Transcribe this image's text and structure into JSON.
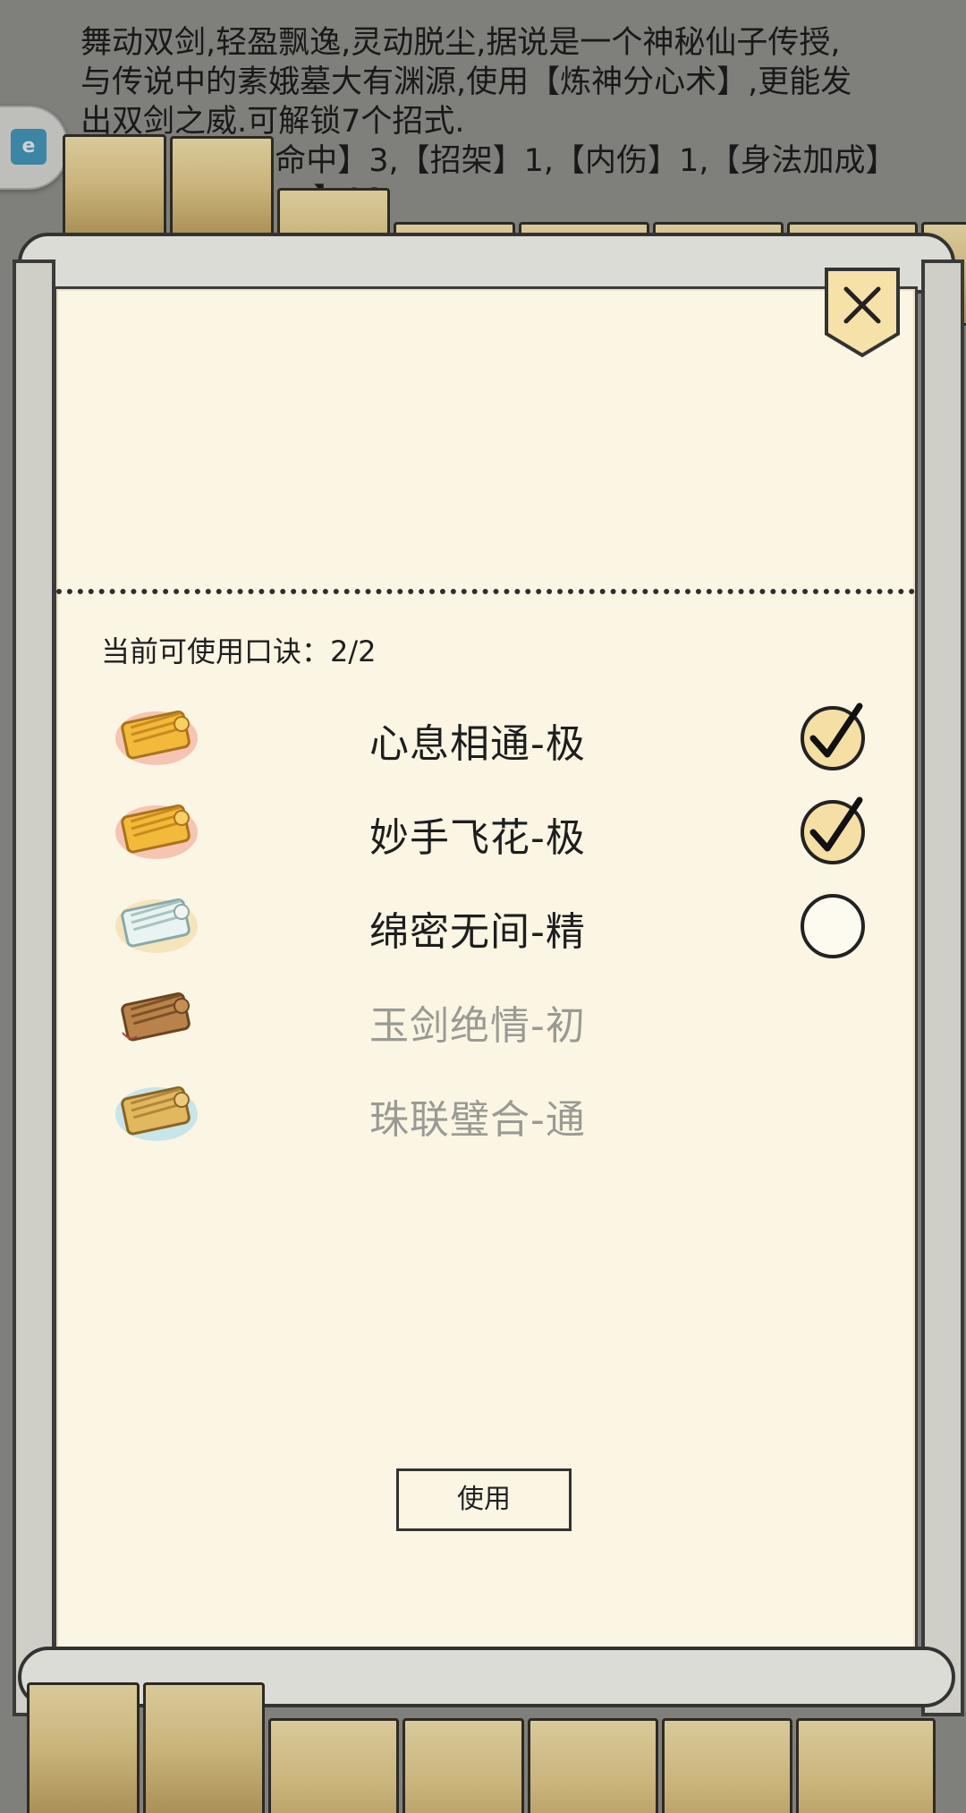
{
  "background": {
    "desc_lines": [
      "舞动双剑,轻盈飘逸,灵动脱尘,据说是一个神秘仙子传授,",
      "与传说中的素娥墓大有渊源,使用【炼神分心术】,更能发",
      "出双剑之威.可解锁7个招式.",
      "1【命中】3,【招架】1,【内伤】1,【身法加成】",
      "】18"
    ]
  },
  "panel": {
    "counter_label": "当前可使用口诀：2/2",
    "use_button": "使用",
    "close_icon": "close-icon"
  },
  "items": [
    {
      "name": "心息相通-极",
      "tier": "gold",
      "checked": true,
      "enabled": true
    },
    {
      "name": "妙手飞花-极",
      "tier": "gold",
      "checked": true,
      "enabled": true
    },
    {
      "name": "绵密无间-精",
      "tier": "white",
      "checked": false,
      "enabled": true
    },
    {
      "name": "玉剑绝情-初",
      "tier": "brown",
      "enabled": false
    },
    {
      "name": "珠联璧合-通",
      "tier": "blue",
      "enabled": false
    }
  ],
  "colors": {
    "paper": "#fbf5e4",
    "check_fill": "#f5dfa4",
    "disabled_text": "#9a9a94"
  }
}
